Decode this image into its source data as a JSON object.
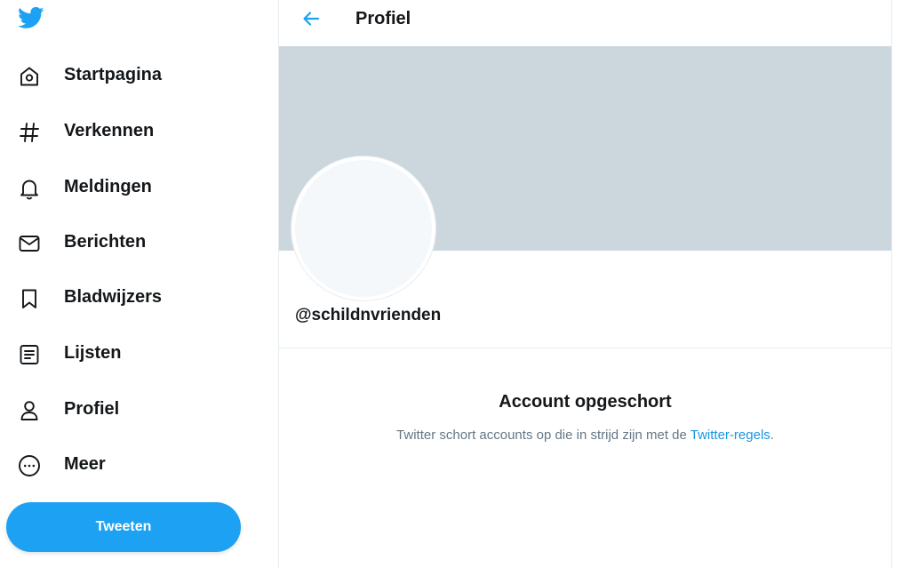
{
  "colors": {
    "accent": "#1da1f2",
    "link": "#1b95e0",
    "banner": "#ccd6dd",
    "muted_text": "#657786"
  },
  "sidebar": {
    "logo_icon": "twitter-bird-icon",
    "items": [
      {
        "label": "Startpagina",
        "icon": "home-icon"
      },
      {
        "label": "Verkennen",
        "icon": "hashtag-icon"
      },
      {
        "label": "Meldingen",
        "icon": "bell-icon"
      },
      {
        "label": "Berichten",
        "icon": "envelope-icon"
      },
      {
        "label": "Bladwijzers",
        "icon": "bookmark-icon"
      },
      {
        "label": "Lijsten",
        "icon": "list-icon"
      },
      {
        "label": "Profiel",
        "icon": "profile-icon"
      },
      {
        "label": "Meer",
        "icon": "more-icon"
      }
    ],
    "tweet_label": "Tweeten"
  },
  "header": {
    "back_icon": "back-arrow-icon",
    "title": "Profiel"
  },
  "profile": {
    "handle": "@schildnvrienden"
  },
  "suspended": {
    "title": "Account opgeschort",
    "text_before": "Twitter schort accounts op die in strijd zijn met de ",
    "link": "Twitter-regels",
    "text_after": "."
  }
}
